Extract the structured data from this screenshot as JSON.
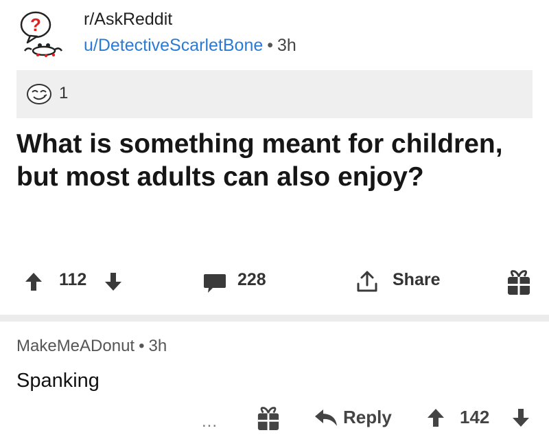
{
  "post": {
    "subreddit": "r/AskReddit",
    "author": "u/DetectiveScarletBone",
    "separator": "•",
    "time": "3h",
    "award_count": "1",
    "title": "What is something meant for children, but most adults can also enjoy?",
    "upvotes": "112",
    "comments": "228",
    "share_label": "Share"
  },
  "comment": {
    "author": "MakeMeADonut",
    "separator": "•",
    "time": "3h",
    "body": "Spanking",
    "more_label": "...",
    "reply_label": "Reply",
    "votes": "142"
  },
  "colors": {
    "author_link": "#2a7bd5",
    "question_mark": "#e02020",
    "award_bar": "#efefef"
  },
  "icons": [
    "askreddit-avatar-icon",
    "award-icon",
    "upvote-icon",
    "downvote-icon",
    "comment-icon",
    "share-icon",
    "gift-icon",
    "more-icon",
    "reply-icon"
  ]
}
